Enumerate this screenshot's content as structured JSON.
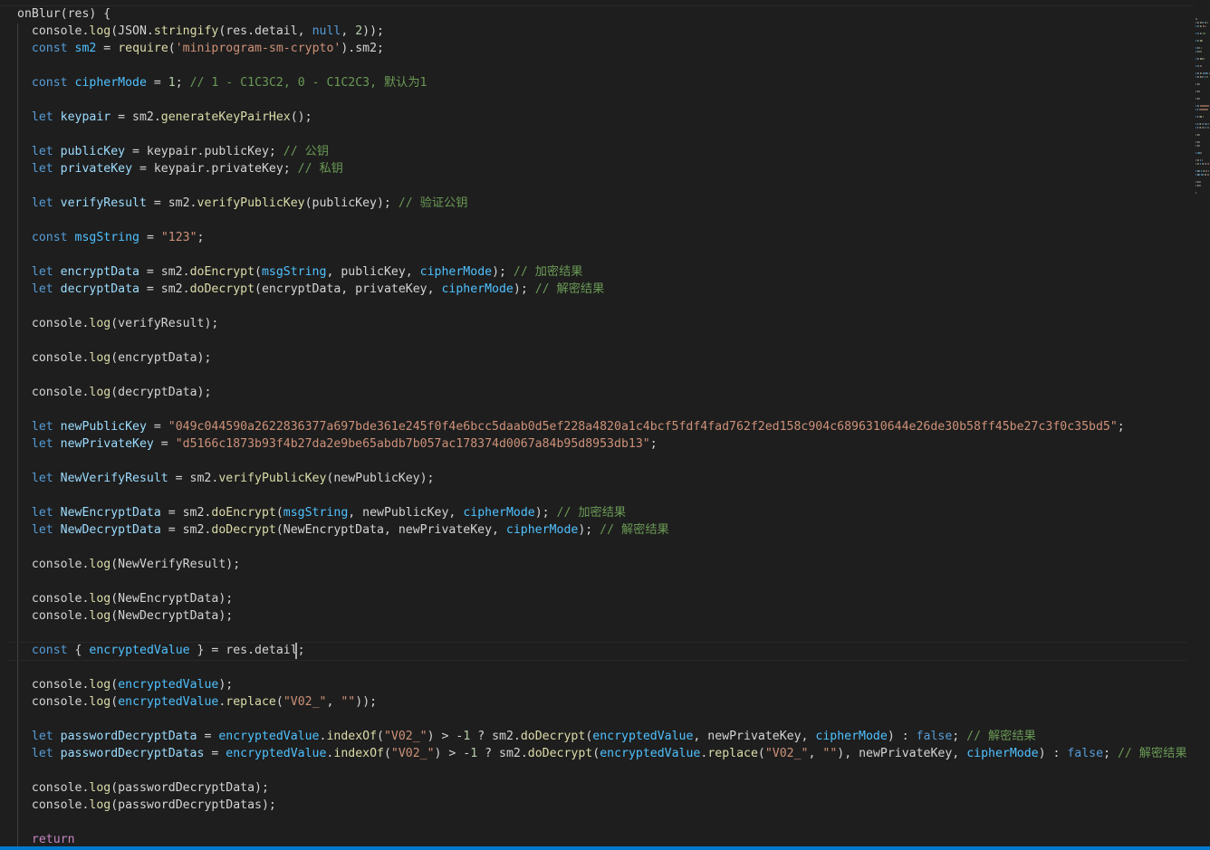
{
  "theme": {
    "background": "#1e1e1e",
    "keyword": "#569cd6",
    "variable": "#9cdcfe",
    "constant": "#4fc1ff",
    "function": "#dcdcaa",
    "string": "#ce9178",
    "number": "#b5cea8",
    "comment": "#6a9955",
    "control": "#c586c0",
    "statusbar": "#007acc"
  },
  "editor": {
    "language": "javascript",
    "cursor_line": 37,
    "lines": [
      [
        [
          "p",
          "onBlur(res) {"
        ]
      ],
      [
        [
          "p",
          "  console."
        ],
        [
          "f",
          "log"
        ],
        [
          "p",
          "(JSON."
        ],
        [
          "f",
          "stringify"
        ],
        [
          "p",
          "(res.detail, "
        ],
        [
          "k",
          "null"
        ],
        [
          "p",
          ", "
        ],
        [
          "n",
          "2"
        ],
        [
          "p",
          "));"
        ]
      ],
      [
        [
          "k",
          "  const "
        ],
        [
          "c",
          "sm2"
        ],
        [
          "p",
          " = "
        ],
        [
          "f",
          "require"
        ],
        [
          "p",
          "("
        ],
        [
          "s",
          "'miniprogram-sm-crypto'"
        ],
        [
          "p",
          ").sm2;"
        ]
      ],
      [
        [
          "p",
          ""
        ]
      ],
      [
        [
          "k",
          "  const "
        ],
        [
          "c",
          "cipherMode"
        ],
        [
          "p",
          " = "
        ],
        [
          "n",
          "1"
        ],
        [
          "p",
          "; "
        ],
        [
          "m",
          "// 1 - C1C3C2, 0 - C1C2C3, 默认为1"
        ]
      ],
      [
        [
          "p",
          ""
        ]
      ],
      [
        [
          "k",
          "  let "
        ],
        [
          "v",
          "keypair"
        ],
        [
          "p",
          " = sm2."
        ],
        [
          "f",
          "generateKeyPairHex"
        ],
        [
          "p",
          "();"
        ]
      ],
      [
        [
          "p",
          ""
        ]
      ],
      [
        [
          "k",
          "  let "
        ],
        [
          "v",
          "publicKey"
        ],
        [
          "p",
          " = keypair.publicKey; "
        ],
        [
          "m",
          "// 公钥"
        ]
      ],
      [
        [
          "k",
          "  let "
        ],
        [
          "v",
          "privateKey"
        ],
        [
          "p",
          " = keypair.privateKey; "
        ],
        [
          "m",
          "// 私钥"
        ]
      ],
      [
        [
          "p",
          ""
        ]
      ],
      [
        [
          "k",
          "  let "
        ],
        [
          "v",
          "verifyResult"
        ],
        [
          "p",
          " = sm2."
        ],
        [
          "f",
          "verifyPublicKey"
        ],
        [
          "p",
          "(publicKey); "
        ],
        [
          "m",
          "// 验证公钥"
        ]
      ],
      [
        [
          "p",
          ""
        ]
      ],
      [
        [
          "k",
          "  const "
        ],
        [
          "c",
          "msgString"
        ],
        [
          "p",
          " = "
        ],
        [
          "s",
          "\"123\""
        ],
        [
          "p",
          ";"
        ]
      ],
      [
        [
          "p",
          ""
        ]
      ],
      [
        [
          "k",
          "  let "
        ],
        [
          "v",
          "encryptData"
        ],
        [
          "p",
          " = sm2."
        ],
        [
          "f",
          "doEncrypt"
        ],
        [
          "p",
          "("
        ],
        [
          "c",
          "msgString"
        ],
        [
          "p",
          ", publicKey, "
        ],
        [
          "c",
          "cipherMode"
        ],
        [
          "p",
          "); "
        ],
        [
          "m",
          "// 加密结果"
        ]
      ],
      [
        [
          "k",
          "  let "
        ],
        [
          "v",
          "decryptData"
        ],
        [
          "p",
          " = sm2."
        ],
        [
          "f",
          "doDecrypt"
        ],
        [
          "p",
          "(encryptData, privateKey, "
        ],
        [
          "c",
          "cipherMode"
        ],
        [
          "p",
          "); "
        ],
        [
          "m",
          "// 解密结果"
        ]
      ],
      [
        [
          "p",
          ""
        ]
      ],
      [
        [
          "p",
          "  console."
        ],
        [
          "f",
          "log"
        ],
        [
          "p",
          "(verifyResult);"
        ]
      ],
      [
        [
          "p",
          ""
        ]
      ],
      [
        [
          "p",
          "  console."
        ],
        [
          "f",
          "log"
        ],
        [
          "p",
          "(encryptData);"
        ]
      ],
      [
        [
          "p",
          ""
        ]
      ],
      [
        [
          "p",
          "  console."
        ],
        [
          "f",
          "log"
        ],
        [
          "p",
          "(decryptData);"
        ]
      ],
      [
        [
          "p",
          ""
        ]
      ],
      [
        [
          "k",
          "  let "
        ],
        [
          "v",
          "newPublicKey"
        ],
        [
          "p",
          " = "
        ],
        [
          "s",
          "\"049c044590a2622836377a697bde361e245f0f4e6bcc5daab0d5ef228a4820a1c4bcf5fdf4fad762f2ed158c904c6896310644e26de30b58ff45be27c3f0c35bd5\""
        ],
        [
          "p",
          ";"
        ]
      ],
      [
        [
          "k",
          "  let "
        ],
        [
          "v",
          "newPrivateKey"
        ],
        [
          "p",
          " = "
        ],
        [
          "s",
          "\"d5166c1873b93f4b27da2e9be65abdb7b057ac178374d0067a84b95d8953db13\""
        ],
        [
          "p",
          ";"
        ]
      ],
      [
        [
          "p",
          ""
        ]
      ],
      [
        [
          "k",
          "  let "
        ],
        [
          "v",
          "NewVerifyResult"
        ],
        [
          "p",
          " = sm2."
        ],
        [
          "f",
          "verifyPublicKey"
        ],
        [
          "p",
          "(newPublicKey);"
        ]
      ],
      [
        [
          "p",
          ""
        ]
      ],
      [
        [
          "k",
          "  let "
        ],
        [
          "v",
          "NewEncryptData"
        ],
        [
          "p",
          " = sm2."
        ],
        [
          "f",
          "doEncrypt"
        ],
        [
          "p",
          "("
        ],
        [
          "c",
          "msgString"
        ],
        [
          "p",
          ", newPublicKey, "
        ],
        [
          "c",
          "cipherMode"
        ],
        [
          "p",
          "); "
        ],
        [
          "m",
          "// 加密结果"
        ]
      ],
      [
        [
          "k",
          "  let "
        ],
        [
          "v",
          "NewDecryptData"
        ],
        [
          "p",
          " = sm2."
        ],
        [
          "f",
          "doDecrypt"
        ],
        [
          "p",
          "(NewEncryptData, newPrivateKey, "
        ],
        [
          "c",
          "cipherMode"
        ],
        [
          "p",
          "); "
        ],
        [
          "m",
          "// 解密结果"
        ]
      ],
      [
        [
          "p",
          ""
        ]
      ],
      [
        [
          "p",
          "  console."
        ],
        [
          "f",
          "log"
        ],
        [
          "p",
          "(NewVerifyResult);"
        ]
      ],
      [
        [
          "p",
          ""
        ]
      ],
      [
        [
          "p",
          "  console."
        ],
        [
          "f",
          "log"
        ],
        [
          "p",
          "(NewEncryptData);"
        ]
      ],
      [
        [
          "p",
          "  console."
        ],
        [
          "f",
          "log"
        ],
        [
          "p",
          "(NewDecryptData);"
        ]
      ],
      [
        [
          "p",
          ""
        ]
      ],
      [
        [
          "k",
          "  const "
        ],
        [
          "p",
          "{ "
        ],
        [
          "c",
          "encryptedValue"
        ],
        [
          "p",
          " } = res.detail;"
        ]
      ],
      [
        [
          "p",
          ""
        ]
      ],
      [
        [
          "p",
          "  console."
        ],
        [
          "f",
          "log"
        ],
        [
          "p",
          "("
        ],
        [
          "c",
          "encryptedValue"
        ],
        [
          "p",
          ");"
        ]
      ],
      [
        [
          "p",
          "  console."
        ],
        [
          "f",
          "log"
        ],
        [
          "p",
          "("
        ],
        [
          "c",
          "encryptedValue"
        ],
        [
          "p",
          "."
        ],
        [
          "f",
          "replace"
        ],
        [
          "p",
          "("
        ],
        [
          "s",
          "\"V02_\""
        ],
        [
          "p",
          ", "
        ],
        [
          "s",
          "\"\""
        ],
        [
          "p",
          "));"
        ]
      ],
      [
        [
          "p",
          ""
        ]
      ],
      [
        [
          "k",
          "  let "
        ],
        [
          "v",
          "passwordDecryptData"
        ],
        [
          "p",
          " = "
        ],
        [
          "c",
          "encryptedValue"
        ],
        [
          "p",
          "."
        ],
        [
          "f",
          "indexOf"
        ],
        [
          "p",
          "("
        ],
        [
          "s",
          "\"V02_\""
        ],
        [
          "p",
          ") > -"
        ],
        [
          "n",
          "1"
        ],
        [
          "p",
          " ? sm2."
        ],
        [
          "f",
          "doDecrypt"
        ],
        [
          "p",
          "("
        ],
        [
          "c",
          "encryptedValue"
        ],
        [
          "p",
          ", newPrivateKey, "
        ],
        [
          "c",
          "cipherMode"
        ],
        [
          "p",
          ") : "
        ],
        [
          "k",
          "false"
        ],
        [
          "p",
          "; "
        ],
        [
          "m",
          "// 解密结果"
        ]
      ],
      [
        [
          "k",
          "  let "
        ],
        [
          "v",
          "passwordDecryptDatas"
        ],
        [
          "p",
          " = "
        ],
        [
          "c",
          "encryptedValue"
        ],
        [
          "p",
          "."
        ],
        [
          "f",
          "indexOf"
        ],
        [
          "p",
          "("
        ],
        [
          "s",
          "\"V02_\""
        ],
        [
          "p",
          ") > -"
        ],
        [
          "n",
          "1"
        ],
        [
          "p",
          " ? sm2."
        ],
        [
          "f",
          "doDecrypt"
        ],
        [
          "p",
          "("
        ],
        [
          "c",
          "encryptedValue"
        ],
        [
          "p",
          "."
        ],
        [
          "f",
          "replace"
        ],
        [
          "p",
          "("
        ],
        [
          "s",
          "\"V02_\""
        ],
        [
          "p",
          ", "
        ],
        [
          "s",
          "\"\""
        ],
        [
          "p",
          "), newPrivateKey, "
        ],
        [
          "c",
          "cipherMode"
        ],
        [
          "p",
          ") : "
        ],
        [
          "k",
          "false"
        ],
        [
          "p",
          "; "
        ],
        [
          "m",
          "// 解密结果"
        ]
      ],
      [
        [
          "p",
          ""
        ]
      ],
      [
        [
          "p",
          "  console."
        ],
        [
          "f",
          "log"
        ],
        [
          "p",
          "(passwordDecryptData);"
        ]
      ],
      [
        [
          "p",
          "  console."
        ],
        [
          "f",
          "log"
        ],
        [
          "p",
          "(passwordDecryptDatas);"
        ]
      ],
      [
        [
          "p",
          ""
        ]
      ],
      [
        [
          "r",
          "  return"
        ]
      ]
    ]
  }
}
